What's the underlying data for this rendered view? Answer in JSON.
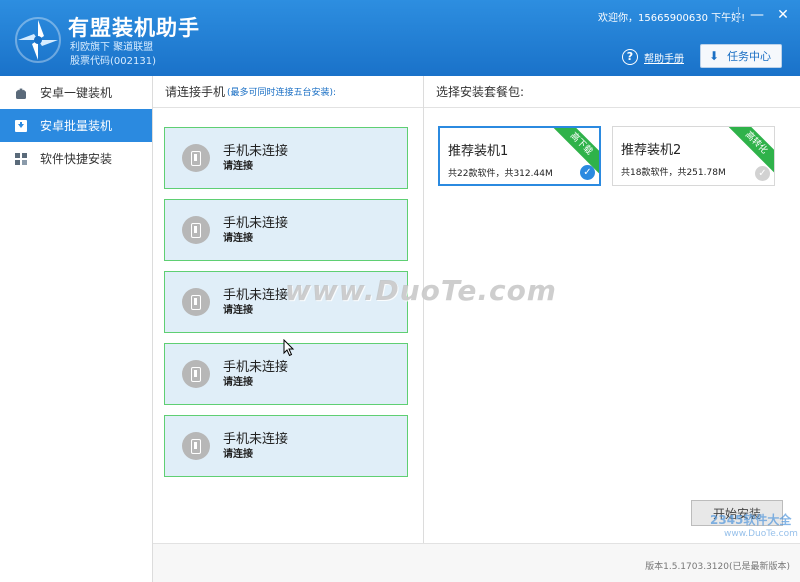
{
  "app": {
    "title": "有盟装机助手",
    "subtitle_line1": "利欧旗下 聚道联盟",
    "subtitle_line2": "股票代码(002131)",
    "welcome": "欢迎你，15665900630  下午好!",
    "help_label": "帮助手册",
    "task_label": "任务中心",
    "minimize": "—",
    "close": "✕"
  },
  "sidebar": {
    "items": [
      {
        "label": "安卓一键装机",
        "icon": "android-icon",
        "active": false
      },
      {
        "label": "安卓批量装机",
        "icon": "batch-install-icon",
        "active": true
      },
      {
        "label": "软件快捷安装",
        "icon": "apps-grid-icon",
        "active": false
      }
    ]
  },
  "phones": {
    "header": "请连接手机",
    "header_note": "(最多可同时连接五台安装):",
    "slots": [
      {
        "title": "手机未连接",
        "sub": "请连接"
      },
      {
        "title": "手机未连接",
        "sub": "请连接"
      },
      {
        "title": "手机未连接",
        "sub": "请连接"
      },
      {
        "title": "手机未连接",
        "sub": "请连接"
      },
      {
        "title": "手机未连接",
        "sub": "请连接"
      }
    ]
  },
  "packages": {
    "header": "选择安装套餐包:",
    "items": [
      {
        "title": "推荐装机1",
        "sub": "共22款软件，共312.44M",
        "ribbon": "高下载",
        "selected": true
      },
      {
        "title": "推荐装机2",
        "sub": "共18款软件，共251.78M",
        "ribbon": "高转化",
        "selected": false
      }
    ]
  },
  "start_button": "开始安装",
  "version": "版本1.5.1703.3120(已是最新版本)",
  "watermark": "www.DuoTe.com",
  "watermark_corner_big": "2345软件大全",
  "watermark_corner_small": "www.DuoTe.com",
  "colors": {
    "header": "#1e7fd6",
    "accent": "#2b8ae0",
    "slot_border": "#5fcf73",
    "ribbon": "#2fb24a"
  }
}
